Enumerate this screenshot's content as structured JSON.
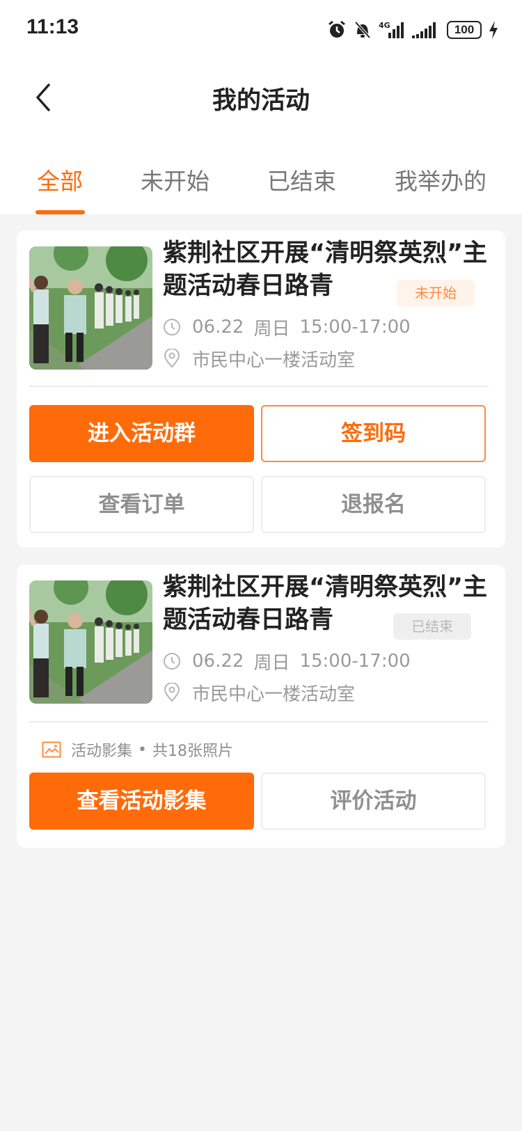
{
  "status": {
    "time": "11:13",
    "battery": "100",
    "network": "4G"
  },
  "header": {
    "title": "我的活动"
  },
  "tabs": [
    {
      "label": "全部",
      "active": true
    },
    {
      "label": "未开始",
      "active": false
    },
    {
      "label": "已结束",
      "active": false
    },
    {
      "label": "我举办的",
      "active": false
    }
  ],
  "cards": [
    {
      "title": "紫荆社区开展“清明祭英烈”主题活动春日路青",
      "status": "未开始",
      "date": "06.22",
      "weekday": "周日",
      "time": "15:00-17:00",
      "location": "市民中心一楼活动室",
      "buttons": {
        "primary": "进入活动群",
        "checkin": "签到码",
        "order": "查看订单",
        "cancel": "退报名"
      }
    },
    {
      "title": "紫荆社区开展“清明祭英烈”主题活动春日路青",
      "status": "已结束",
      "date": "06.22",
      "weekday": "周日",
      "time": "15:00-17:00",
      "location": "市民中心一楼活动室",
      "album_label": "活动影集",
      "album_count": "共18张照片",
      "buttons": {
        "primary": "查看活动影集",
        "review": "评价活动"
      }
    }
  ],
  "colors": {
    "accent": "#ff6b09",
    "background": "#f4f4f4"
  },
  "icons": [
    "alarm-icon",
    "bell-off-icon",
    "signal-icon",
    "battery-icon",
    "back-arrow-icon",
    "clock-icon",
    "location-icon",
    "image-icon"
  ]
}
